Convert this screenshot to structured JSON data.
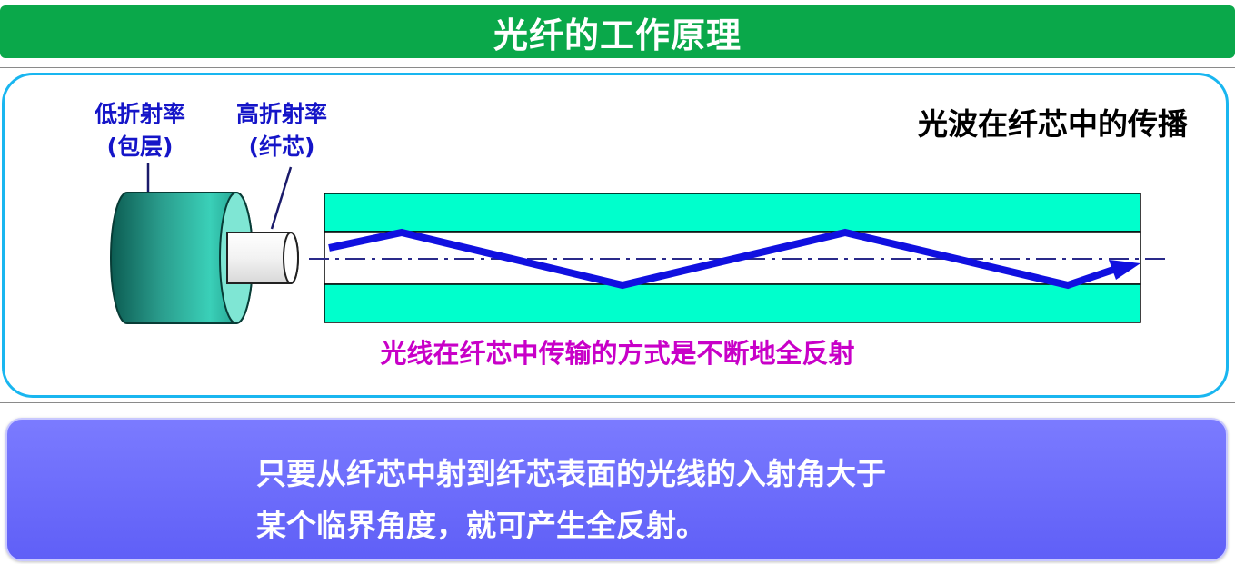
{
  "title": "光纤的工作原理",
  "cable": {
    "cladding_label": "低折射率",
    "cladding_sub": "(包层)",
    "core_label": "高折射率",
    "core_sub": "(纤芯)"
  },
  "caption_right": "光波在纤芯中的传播",
  "caption_bottom": "光线在纤芯中传输的方式是不断地全反射",
  "info": {
    "line1": "只要从纤芯中射到纤芯表面的光线的入射角大于",
    "line2": "某个临界角度，就可产生全反射。"
  },
  "colors": {
    "title_bg": "#0aa84a",
    "panel_border": "#19b6f0",
    "cladding": "#00ffcc",
    "ray": "#1010e0",
    "axis": "#2a2a8a",
    "caption_magenta": "#c800c8",
    "info_bg": "#6b6bfb"
  }
}
